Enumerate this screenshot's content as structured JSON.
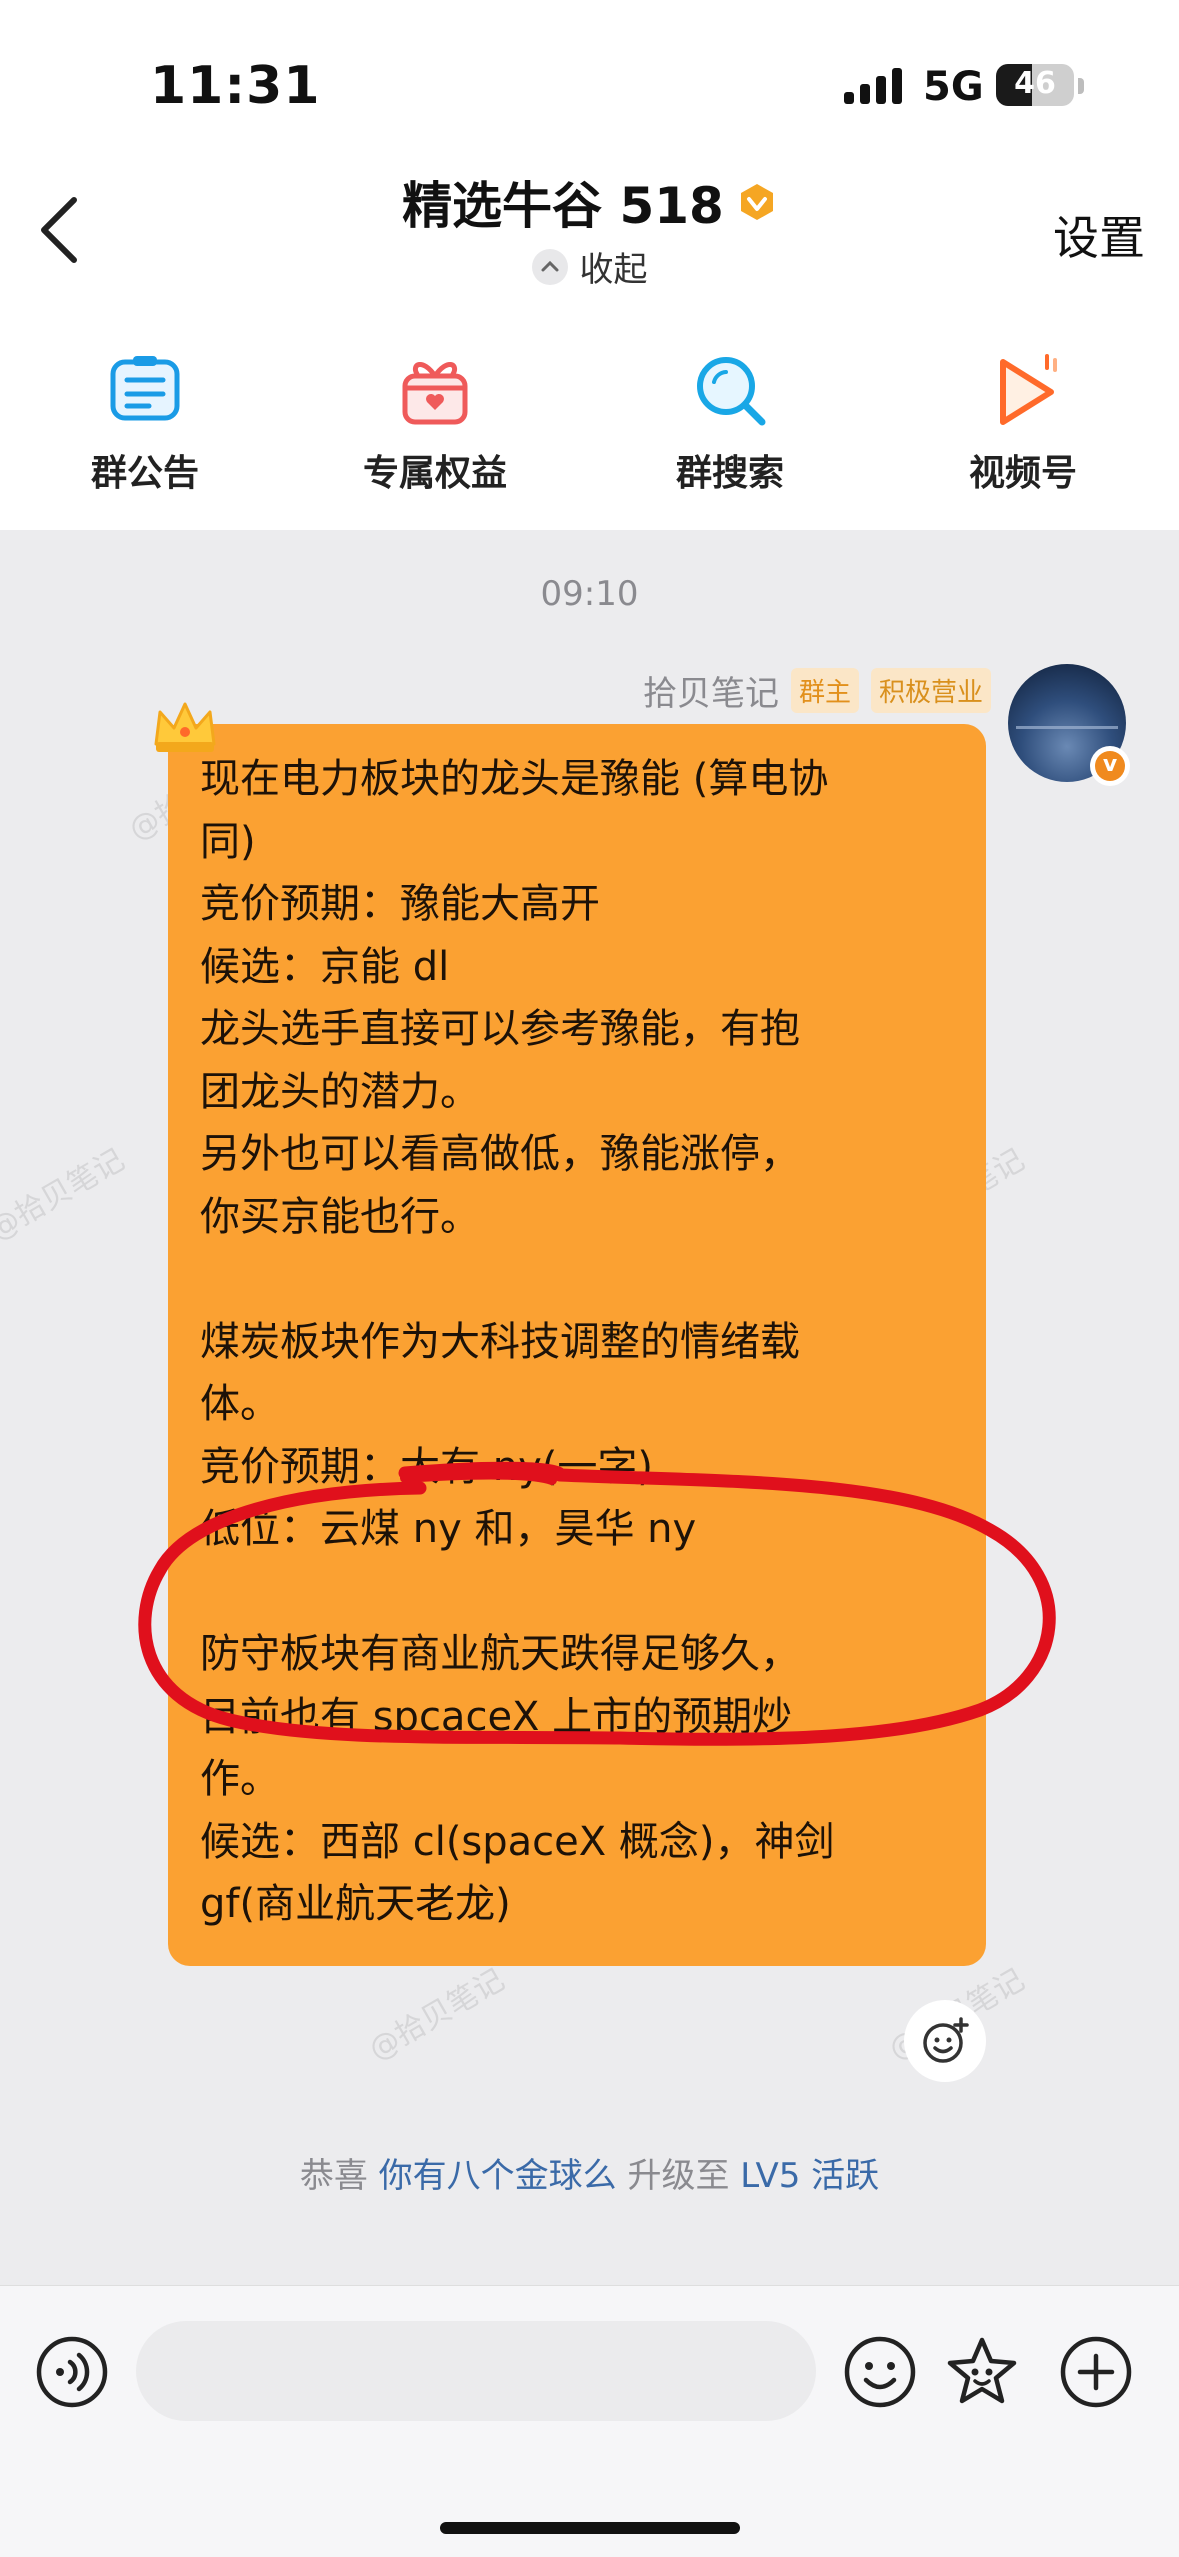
{
  "status_bar": {
    "time": "11:31",
    "network": "5G",
    "battery": "46",
    "battery_level": 0.46
  },
  "header": {
    "title": "精选牛谷 518",
    "collapse_label": "收起",
    "settings_label": "设置"
  },
  "quick_menu": [
    {
      "label": "群公告",
      "icon": "announcement-icon"
    },
    {
      "label": "专属权益",
      "icon": "gift-icon"
    },
    {
      "label": "群搜索",
      "icon": "search-icon"
    },
    {
      "label": "视频号",
      "icon": "video-channel-icon"
    }
  ],
  "chat": {
    "timestamp": "09:10",
    "message": {
      "sender_name": "拾贝笔记",
      "tags": [
        "群主",
        "积极营业"
      ],
      "lines": [
        "现在电力板块的龙头是豫能 (算电协",
        "同)",
        "竞价预期：豫能大高开",
        "候选：京能 dl",
        "龙头选手直接可以参考豫能，有抱",
        "团龙头的潜力。",
        "另外也可以看高做低，豫能涨停，",
        "你买京能也行。",
        "",
        "煤炭板块作为大科技调整的情绪载",
        "体。",
        "竞价预期：大有 ny(一字)",
        "低位：云煤 ny 和，昊华 ny",
        "",
        "防守板块有商业航天跌得足够久，",
        "目前也有 spcaceX 上市的预期炒",
        "作。",
        "候选：西部 cl(spaceX 概念)，神剑",
        "gf(商业航天老龙)"
      ]
    },
    "system_message": {
      "prefix": "恭喜",
      "name": "你有八个金球么",
      "middle": "升级至",
      "level": "LV5 活跃"
    },
    "watermark": "@拾贝笔记"
  },
  "input_bar": {
    "placeholder": ""
  },
  "colors": {
    "bubble": "#fba132",
    "annotation": "#e0101c",
    "link": "#3a6aa8"
  }
}
